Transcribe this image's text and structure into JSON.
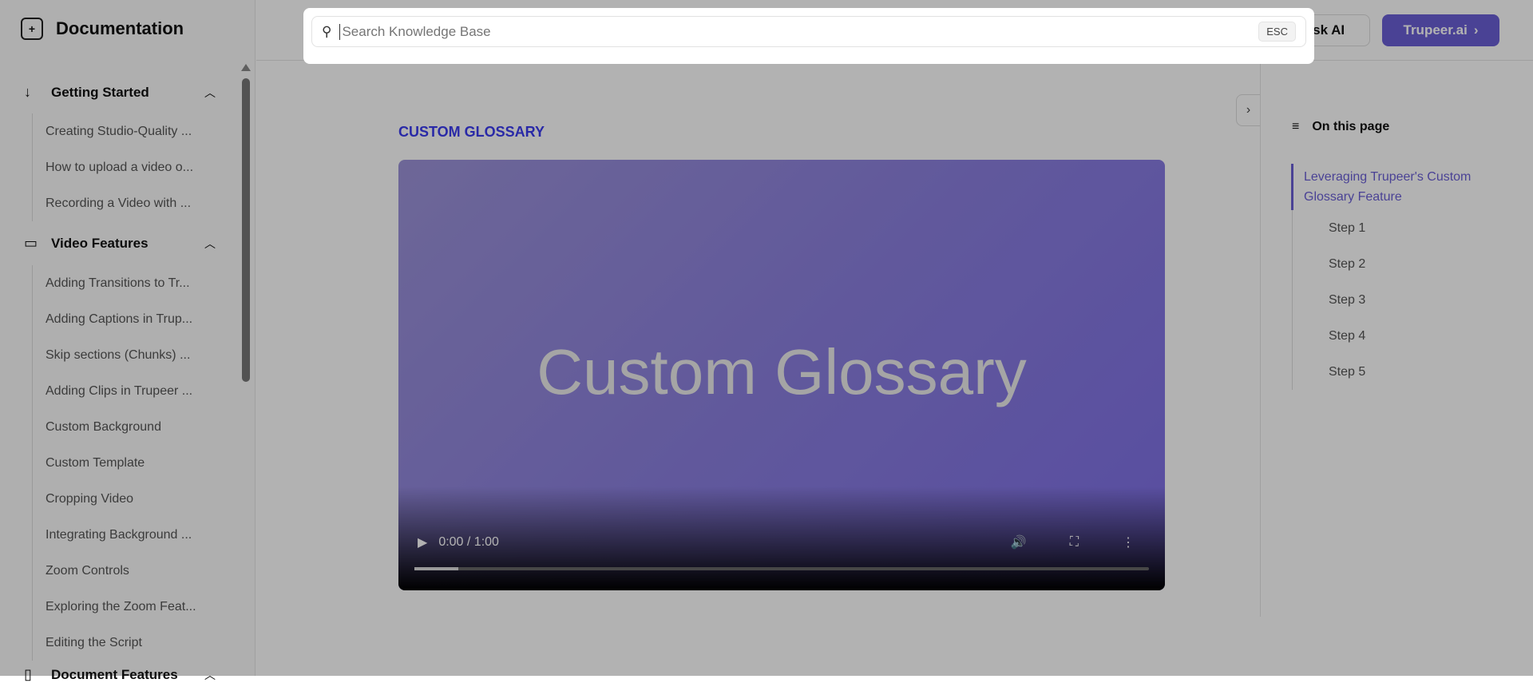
{
  "sidebar": {
    "title": "Documentation",
    "groups": [
      {
        "label": "Getting Started",
        "items": [
          "Creating Studio-Quality ...",
          "How to upload a video o...",
          "Recording a Video with ..."
        ]
      },
      {
        "label": "Video Features",
        "items": [
          "Adding Transitions to Tr...",
          "Adding Captions in Trup...",
          "Skip sections (Chunks) ...",
          "Adding Clips in Trupeer ...",
          "Custom Background",
          "Custom Template",
          "Cropping Video",
          "Integrating Background ...",
          "Zoom Controls",
          "Exploring the Zoom Feat...",
          "Editing the Script"
        ]
      },
      {
        "label": "Document Features"
      }
    ]
  },
  "header": {
    "ask_ai": "Ask AI",
    "trupeer": "Trupeer.ai",
    "trupeer_icon": "›"
  },
  "search": {
    "placeholder": "Search Knowledge Base",
    "value": "",
    "esc": "ESC"
  },
  "main": {
    "kicker": "CUSTOM GLOSSARY",
    "video": {
      "title": "Custom Glossary",
      "time": "0:00 / 1:00",
      "progress": 0.06
    }
  },
  "toc": {
    "heading": "On this page",
    "active": "Leveraging Trupeer's Custom Glossary Feature",
    "steps": [
      "Step 1",
      "Step 2",
      "Step 3",
      "Step 4",
      "Step 5"
    ]
  },
  "colors": {
    "accent": "#6b5fd6",
    "kicker": "#3b3bf0"
  }
}
